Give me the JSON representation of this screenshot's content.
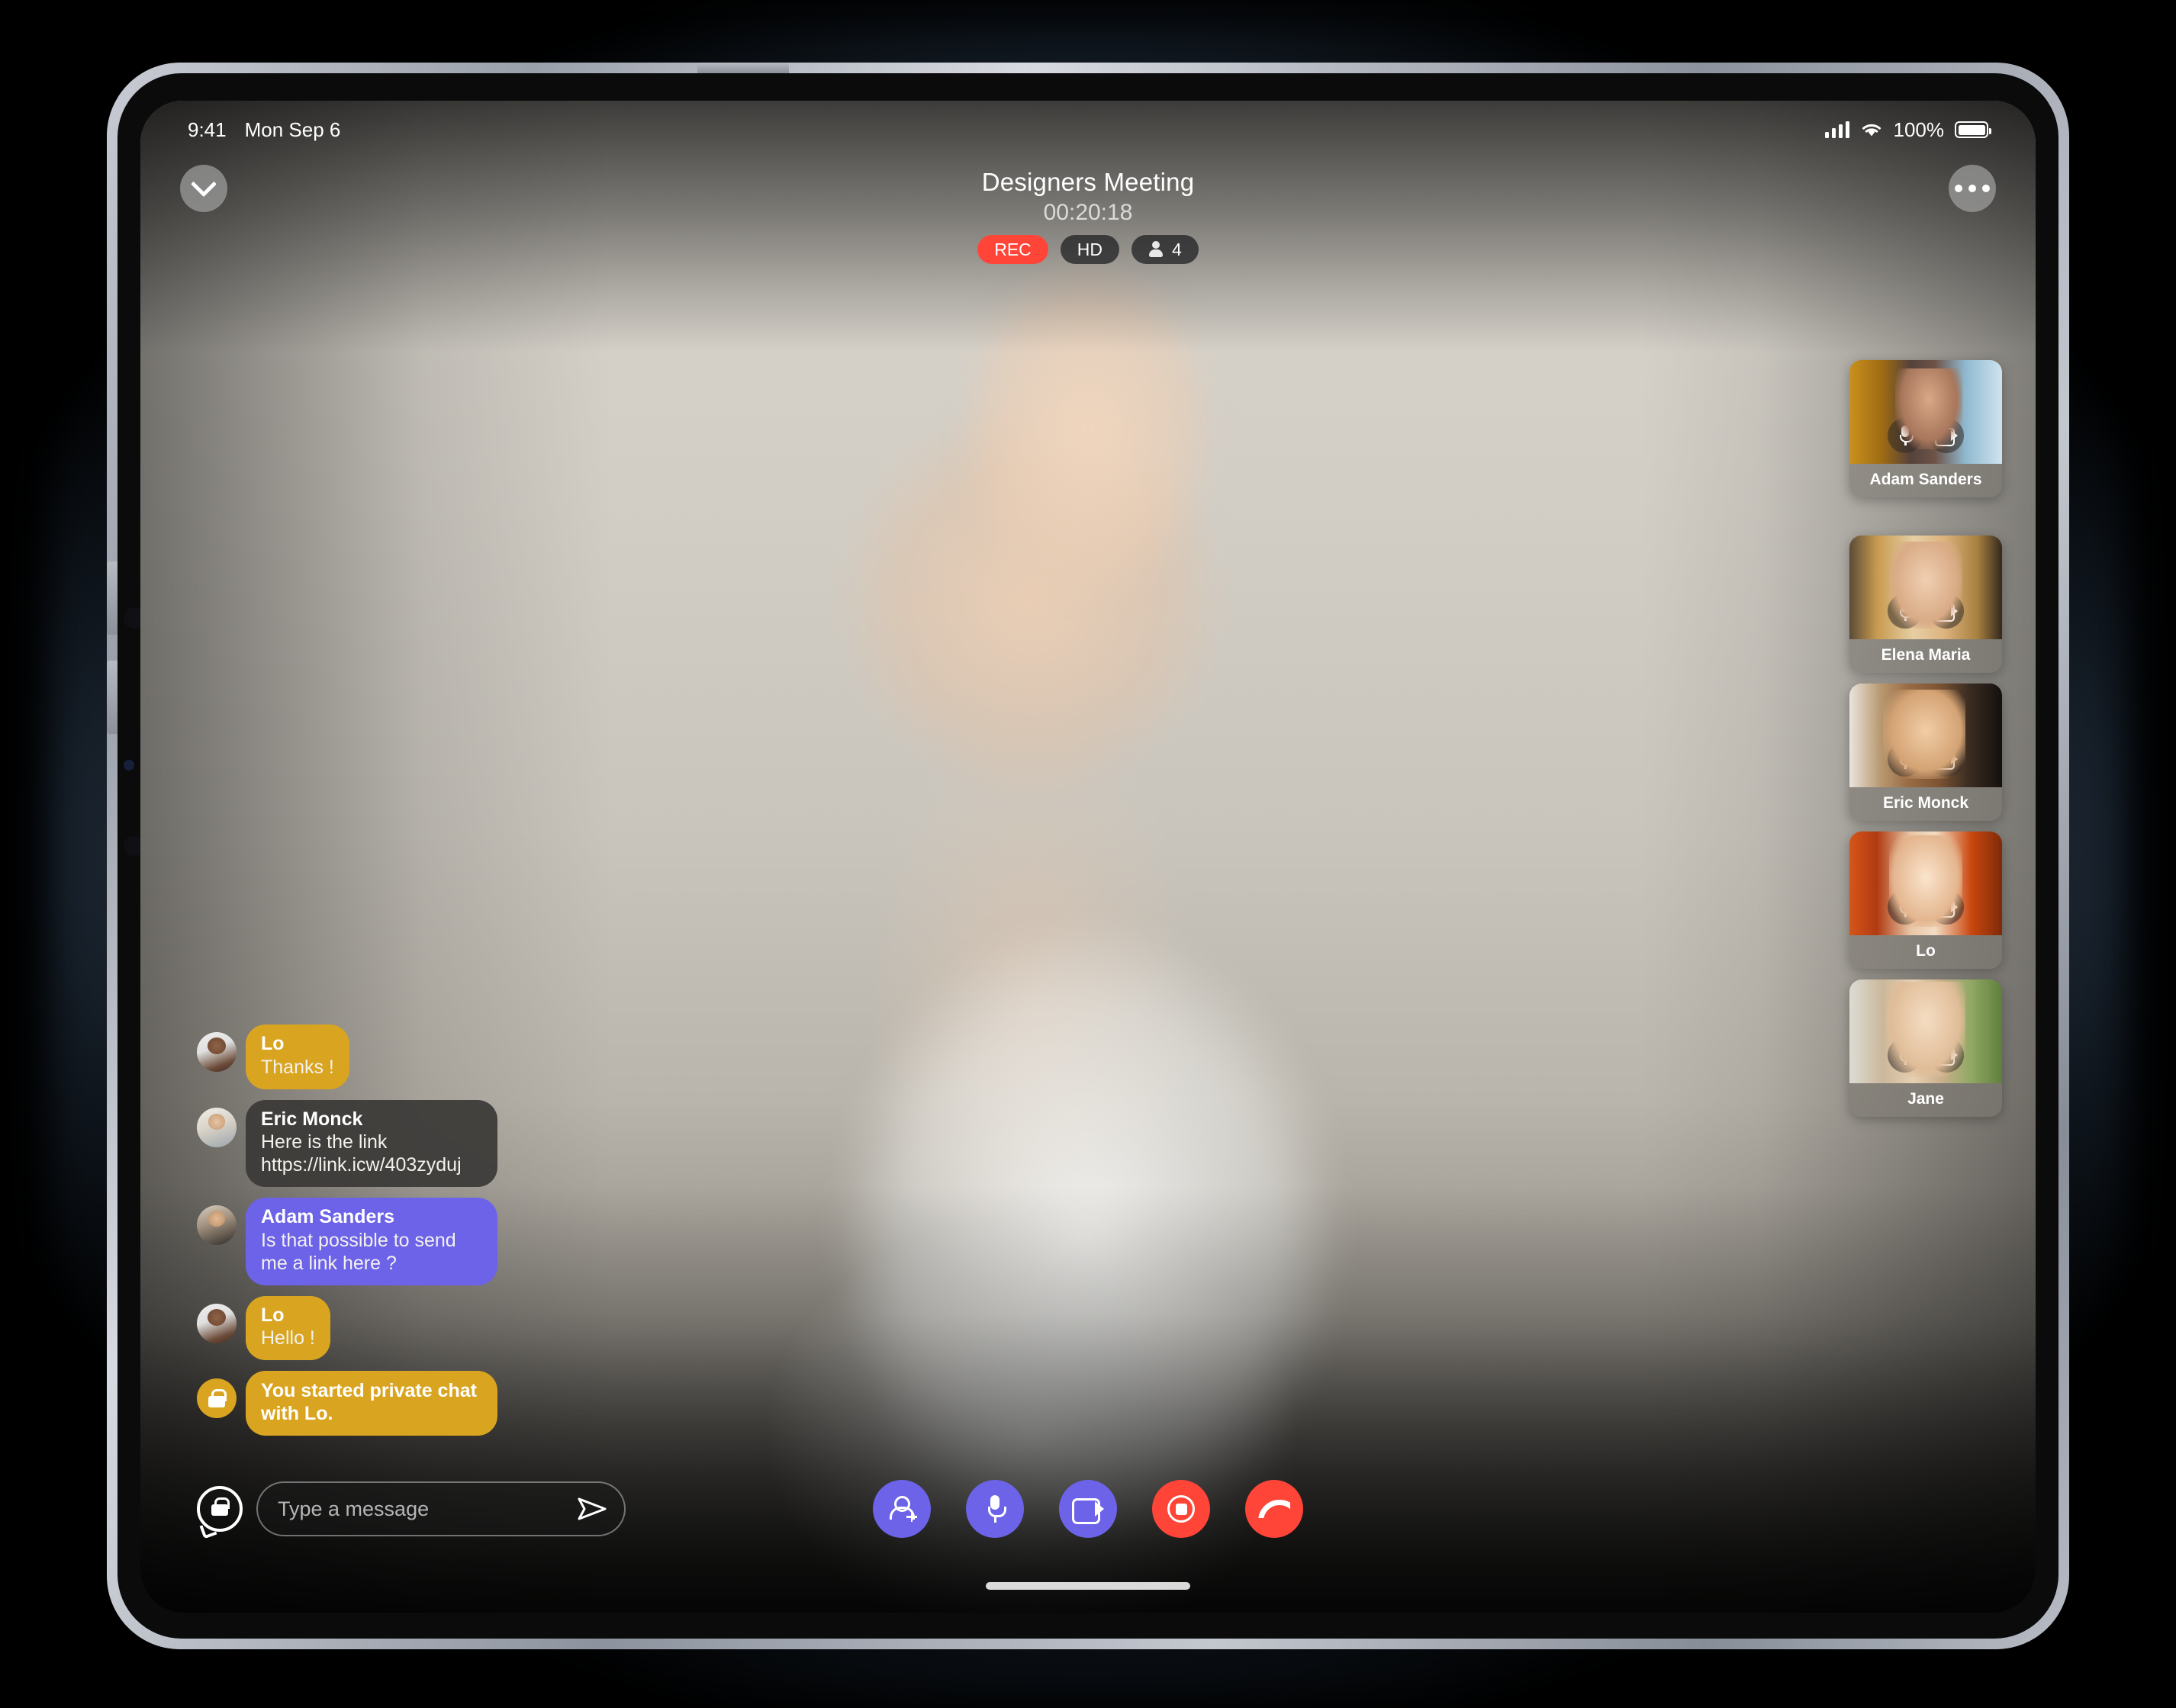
{
  "status_bar": {
    "time": "9:41",
    "date": "Mon Sep 6",
    "battery_percent": "100%",
    "icons": [
      "cellular-signal-icon",
      "wifi-icon",
      "battery-icon"
    ]
  },
  "header": {
    "minimize_icon": "chevron-down-icon",
    "more_options_icon": "more-options-icon",
    "meeting_title": "Designers Meeting",
    "timer": "00:20:18",
    "badges": [
      {
        "label": "REC",
        "type": "recording",
        "color": "#FF4438"
      },
      {
        "label": "HD",
        "type": "quality",
        "color": "#1C1C1E"
      },
      {
        "label": "4",
        "type": "participants",
        "icon": "people-icon",
        "color": "#1C1C1E"
      }
    ]
  },
  "participants": [
    {
      "name": "Adam Sanders",
      "mic_icon": "microphone-icon",
      "camera_icon": "video-camera-icon",
      "art": "t-adam"
    },
    {
      "name": "Elena Maria",
      "mic_icon": "microphone-icon",
      "camera_icon": "video-camera-icon",
      "art": "t-elena"
    },
    {
      "name": "Eric Monck",
      "mic_icon": "microphone-icon",
      "camera_icon": "video-camera-icon",
      "art": "t-eric"
    },
    {
      "name": "Lo",
      "mic_icon": "microphone-icon",
      "camera_icon": "video-camera-icon",
      "art": "t-lo"
    },
    {
      "name": "Jane",
      "mic_icon": "microphone-icon",
      "camera_icon": "video-camera-icon",
      "art": "t-jane"
    }
  ],
  "chat": {
    "messages": [
      {
        "sender": "Lo",
        "text": "Thanks !",
        "style": "yellow",
        "avatar": "av-lo"
      },
      {
        "sender": "Eric Monck",
        "text": "Here is the link https://link.icw/403zyduj",
        "style": "dark",
        "avatar": "av-eric"
      },
      {
        "sender": "Adam Sanders",
        "text": "Is that possible to send me a link here ?",
        "style": "purple",
        "avatar": "av-adam"
      },
      {
        "sender": "Lo",
        "text": "Hello !",
        "style": "yellow",
        "avatar": "av-lo"
      }
    ],
    "system_message": "You started private chat with Lo.",
    "system_icon": "lock-icon"
  },
  "composer": {
    "private_chat_icon": "lock-chat-bubble-icon",
    "input_value": "",
    "placeholder": "Type a message",
    "send_icon": "send-icon"
  },
  "call_controls": [
    {
      "name": "add-participant",
      "icon": "add-user-icon",
      "color": "#6C63E8"
    },
    {
      "name": "microphone",
      "icon": "microphone-icon",
      "color": "#6C63E8"
    },
    {
      "name": "camera",
      "icon": "video-camera-icon",
      "color": "#6C63E8"
    },
    {
      "name": "stop-recording",
      "icon": "stop-record-icon",
      "color": "#FF4438"
    },
    {
      "name": "end-call",
      "icon": "end-call-icon",
      "color": "#FF4438"
    }
  ],
  "colors": {
    "accent_purple": "#6C63E8",
    "accent_red": "#FF4438",
    "accent_yellow": "#D9A520"
  }
}
